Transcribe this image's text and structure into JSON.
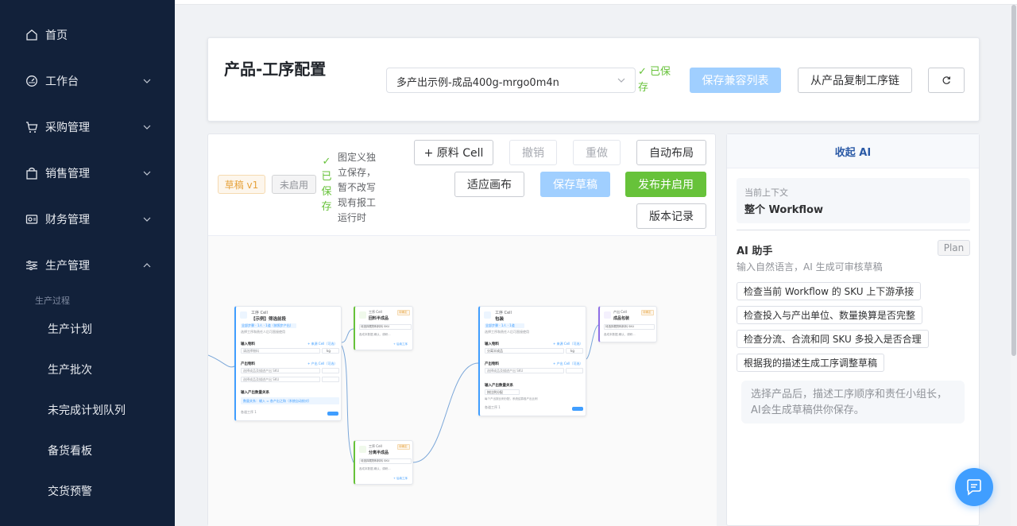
{
  "sidebar": {
    "items": [
      {
        "label": "首页",
        "icon": "home-icon",
        "has_arrow": false
      },
      {
        "label": "工作台",
        "icon": "dashboard-icon",
        "has_arrow": true
      },
      {
        "label": "采购管理",
        "icon": "cart-icon",
        "has_arrow": true
      },
      {
        "label": "销售管理",
        "icon": "bag-icon",
        "has_arrow": true
      },
      {
        "label": "财务管理",
        "icon": "finance-icon",
        "has_arrow": true
      },
      {
        "label": "生产管理",
        "icon": "sliders-icon",
        "has_arrow": true,
        "expanded": true
      }
    ],
    "group_title": "生产过程",
    "sub_items": [
      "生产计划",
      "生产批次",
      "未完成计划队列",
      "备货看板",
      "交货预警"
    ]
  },
  "header": {
    "title": "产品-工序配置",
    "product_select": "多产出示例-成品400g-mrgo0m4n",
    "saved_status": "✓ 已保存",
    "save_compat_label": "保存兼容列表",
    "copy_chain_label": "从产品复制工序链",
    "refresh_icon": "refresh-icon"
  },
  "toolbar": {
    "draft_tag": "草稿 v1",
    "disabled_tag": "未启用",
    "saved_status": "✓ 已保存",
    "note": "图定义独立保存，暂不改写现有报工运行时",
    "add_raw_cell": "+ 原料 Cell",
    "undo": "撤销",
    "redo": "重做",
    "auto_layout": "自动布局",
    "fit_canvas": "适应画布",
    "save_draft": "保存草稿",
    "publish": "发布并启用",
    "history": "版本记录"
  },
  "flow": {
    "nodes": [
      {
        "type_label": "工序 Cell",
        "title": "【示例】筛选前段",
        "chip": "全部步骤 · 1人 · 1道（按照步产出）",
        "hint": "选择工序和责任人后可直接使用",
        "in_label": "输入物料",
        "in_link": "+ 来源 Cell（可选）",
        "in_field": "请选择物料",
        "unit": "kg",
        "out_label": "产出物料",
        "out_link": "+ 产出 Cell（可选）",
        "out_field1": "选择成品及描述产出 SKU",
        "out_field2": "选择成品及描述产出 SKU",
        "ratio_label": "输入产出数量关系",
        "ratio_chip": "数量关系：输入 = 各产出之和（系统自动校对）",
        "count": "各道工序 1"
      },
      {
        "type_label": "工序 Cell",
        "title": "回料半成品",
        "tag": "待确定",
        "field": "待选择载物料料料 SKU",
        "desc": "各成本数据,确认、调研…",
        "link": "+ 后续工序"
      },
      {
        "type_label": "工序 Cell",
        "title": "分离半成品",
        "tag": "待确定",
        "field": "待选择载物料料料 SKU",
        "desc": "各成本数据,确认、调研…",
        "link": "+ 后续工序"
      },
      {
        "type_label": "工序 Cell",
        "title": "包装",
        "chip": "全部步骤 · 1人 · 1道",
        "hint": "选择工序和责任人后可直接使用",
        "in_label": "输入物料",
        "in_link": "+ 来源 Cell（可选）",
        "in_field": "分离半成品",
        "unit": "kg",
        "out_label": "产出物料",
        "out_link": "+ 产出 Cell（可选）",
        "out_field": "选择成品及描述产出 SKU",
        "ratio_label": "输入产出数量关系",
        "ratio_field": "按比例分配",
        "desc": "每个产出按比例分配，系统结算各产出比例",
        "count": "各道工序 1"
      },
      {
        "type_label": "产出 Cell",
        "title": "成品包装",
        "tag": "待确定",
        "field": "待选择载物料料料 SKU",
        "desc": "各成本数据,确认、调研…"
      }
    ]
  },
  "ai_panel": {
    "collapse_label": "收起 AI",
    "context_label": "当前上下文",
    "context_value": "整个 Workflow",
    "title": "AI 助手",
    "plan_tag": "Plan",
    "subtitle": "输入自然语言，AI 生成可审核草稿",
    "suggestions": [
      "检查当前 Workflow 的 SKU 上下游承接",
      "检查投入与产出单位、数量换算是否完整",
      "检查分流、合流和同 SKU 多投入是否合理",
      "根据我的描述生成工序调整草稿"
    ],
    "input_placeholder": "选择产品后，描述工序顺序和责任小组长，AI会生成草稿供你保存。"
  },
  "chat_fab_icon": "chat-icon"
}
